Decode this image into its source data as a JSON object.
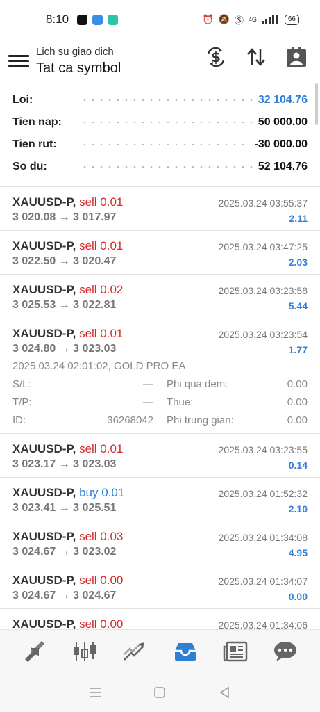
{
  "status_bar": {
    "time": "8:10",
    "battery": "66",
    "network": "4G"
  },
  "header": {
    "subtitle": "Lich su giao dich",
    "title": "Tat ca symbol"
  },
  "summary": [
    {
      "label": "Loi:",
      "value": "32 104.76"
    },
    {
      "label": "Tien nap:",
      "value": "50 000.00"
    },
    {
      "label": "Tien rut:",
      "value": "-30 000.00"
    },
    {
      "label": "So du:",
      "value": "52 104.76"
    }
  ],
  "deals": [
    {
      "symbol": "XAUUSD-P,",
      "side": "sell 0.01",
      "time": "2025.03.24 03:55:37",
      "prices": "3 020.08 → 3 017.97",
      "profit": "2.11"
    },
    {
      "symbol": "XAUUSD-P,",
      "side": "sell 0.01",
      "time": "2025.03.24 03:47:25",
      "prices": "3 022.50 → 3 020.47",
      "profit": "2.03"
    },
    {
      "symbol": "XAUUSD-P,",
      "side": "sell 0.02",
      "time": "2025.03.24 03:23:58",
      "prices": "3 025.53 → 3 022.81",
      "profit": "5.44"
    },
    {
      "symbol": "XAUUSD-P,",
      "side": "sell 0.01",
      "time": "2025.03.24 03:23:54",
      "prices": "3 024.80 → 3 023.03",
      "profit": "1.77"
    },
    {
      "symbol": "XAUUSD-P,",
      "side": "sell 0.01",
      "time": "2025.03.24 03:23:55",
      "prices": "3 023.17 → 3 023.03",
      "profit": "0.14"
    },
    {
      "symbol": "XAUUSD-P,",
      "side": "buy 0.01",
      "time": "2025.03.24 01:52:32",
      "prices": "3 023.41 → 3 025.51",
      "profit": "2.10"
    },
    {
      "symbol": "XAUUSD-P,",
      "side": "sell 0.03",
      "time": "2025.03.24 01:34:08",
      "prices": "3 024.67 → 3 023.02",
      "profit": "4.95"
    },
    {
      "symbol": "XAUUSD-P,",
      "side": "sell 0.00",
      "time": "2025.03.24 01:34:07",
      "prices": "3 024.67 → 3 024.67",
      "profit": "0.00"
    },
    {
      "symbol": "XAUUSD-P,",
      "side": "sell 0.00",
      "time": "2025.03.24 01:34:06",
      "prices": "",
      "profit": ""
    }
  ],
  "detail": {
    "header": "2025.03.24 02:01:02, GOLD PRO EA",
    "sl_label": "S/L:",
    "sl_value": "—",
    "tp_label": "T/P:",
    "tp_value": "—",
    "id_label": "ID:",
    "id_value": "36268042",
    "swap_label": "Phi qua dem:",
    "swap_value": "0.00",
    "tax_label": "Thue:",
    "tax_value": "0.00",
    "commission_label": "Phi trung gian:",
    "commission_value": "0.00"
  },
  "colors": {
    "accent": "#2f7fd4",
    "sell": "#d32b2b",
    "buy": "#2f7fd4"
  },
  "icons": {
    "header": [
      "currency-exchange-icon",
      "sort-icon",
      "account-card-icon"
    ],
    "bottom_nav": [
      "quotes-icon",
      "chart-icon",
      "trade-icon",
      "history-icon",
      "news-icon",
      "chat-icon"
    ],
    "system_nav": [
      "recents-icon",
      "home-icon",
      "back-icon"
    ]
  }
}
